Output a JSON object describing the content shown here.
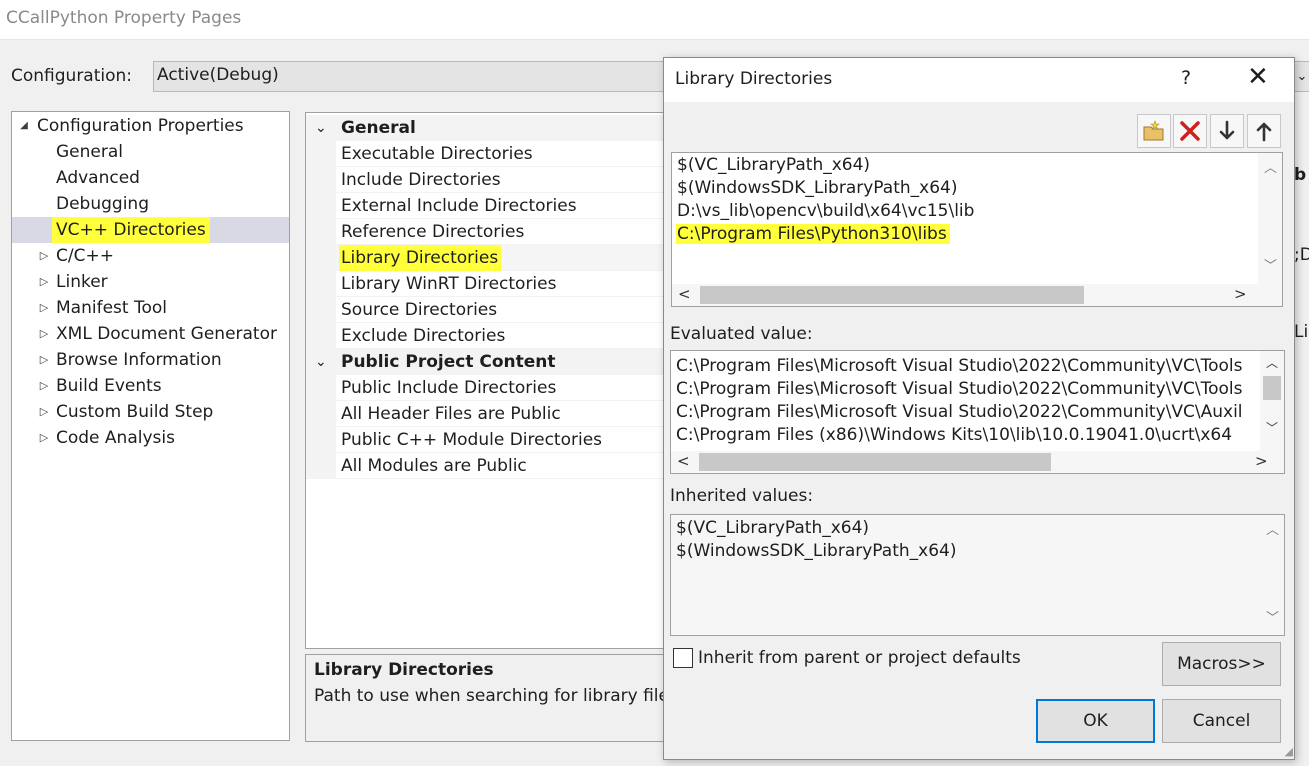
{
  "window": {
    "title": "CCallPython Property Pages",
    "configuration_label": "Configuration:",
    "configuration_value": "Active(Debug)"
  },
  "tree": {
    "root": "Configuration Properties",
    "items": [
      {
        "label": "General",
        "expandable": false
      },
      {
        "label": "Advanced",
        "expandable": false
      },
      {
        "label": "Debugging",
        "expandable": false
      },
      {
        "label": "VC++ Directories",
        "expandable": false,
        "selected": true
      },
      {
        "label": "C/C++",
        "expandable": true
      },
      {
        "label": "Linker",
        "expandable": true
      },
      {
        "label": "Manifest Tool",
        "expandable": true
      },
      {
        "label": "XML Document Generator",
        "expandable": true
      },
      {
        "label": "Browse Information",
        "expandable": true
      },
      {
        "label": "Build Events",
        "expandable": true
      },
      {
        "label": "Custom Build Step",
        "expandable": true
      },
      {
        "label": "Code Analysis",
        "expandable": true
      }
    ]
  },
  "grid": {
    "categories": [
      {
        "label": "General",
        "items": [
          "Executable Directories",
          "Include Directories",
          "External Include Directories",
          "Reference Directories",
          "Library Directories",
          "Library WinRT Directories",
          "Source Directories",
          "Exclude Directories"
        ]
      },
      {
        "label": "Public Project Content",
        "items": [
          "Public Include Directories",
          "All Header Files are Public",
          "Public C++ Module Directories",
          "All Modules are Public"
        ]
      }
    ]
  },
  "description": {
    "title": "Library Directories",
    "text": "Path to use when searching for library files"
  },
  "right_edge_fragments": [
    "b",
    ";D",
    "Li"
  ],
  "dialog": {
    "title": "Library Directories",
    "help": "?",
    "close": "✕",
    "toolbar": {
      "new_line_icon": "folder-new-icon",
      "delete_icon": "delete-icon",
      "move_down_icon": "arrow-down-icon",
      "move_up_icon": "arrow-up-icon"
    },
    "entries": [
      "$(VC_LibraryPath_x64)",
      "$(WindowsSDK_LibraryPath_x64)",
      "D:\\vs_lib\\opencv\\build\\x64\\vc15\\lib",
      "C:\\Program Files\\Python310\\libs"
    ],
    "evaluated_label": "Evaluated value:",
    "evaluated_values": [
      "C:\\Program Files\\Microsoft Visual Studio\\2022\\Community\\VC\\Tools",
      "C:\\Program Files\\Microsoft Visual Studio\\2022\\Community\\VC\\Tools",
      "C:\\Program Files\\Microsoft Visual Studio\\2022\\Community\\VC\\Auxil",
      "C:\\Program Files (x86)\\Windows Kits\\10\\lib\\10.0.19041.0\\ucrt\\x64"
    ],
    "inherited_label": "Inherited values:",
    "inherited_values": [
      "$(VC_LibraryPath_x64)",
      "$(WindowsSDK_LibraryPath_x64)"
    ],
    "inherit_checkbox_label": "Inherit from parent or project defaults",
    "inherit_checked": false,
    "macros_button": "Macros>>",
    "ok_button": "OK",
    "cancel_button": "Cancel"
  },
  "colors": {
    "highlight": "#ffff3c",
    "selection": "#d9d9e6",
    "default_button_border": "#0078d7",
    "delete_red": "#d0201c"
  }
}
